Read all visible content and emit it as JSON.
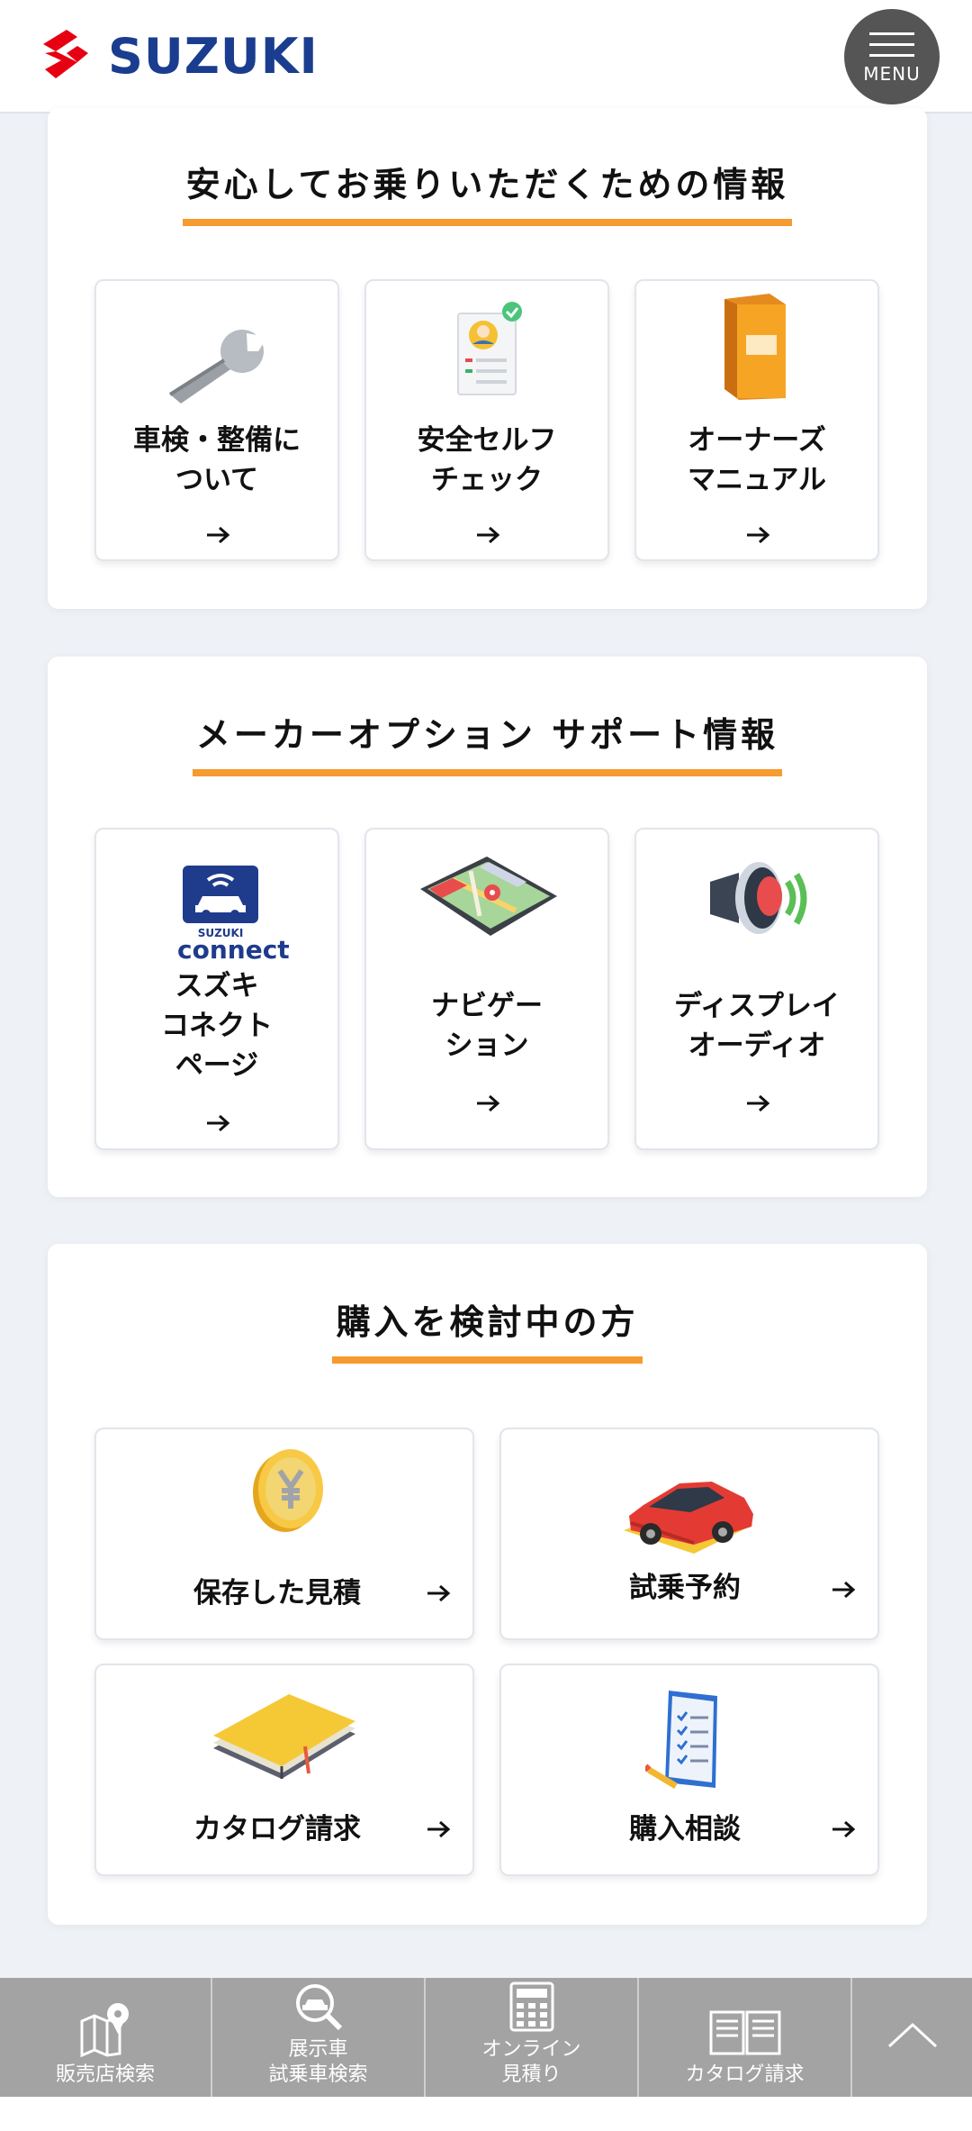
{
  "header": {
    "brand": "SUZUKI",
    "menu_label": "MENU",
    "brand_color": "#1a3d8f",
    "logo_color": "#e60012"
  },
  "sections": [
    {
      "title": "安心してお乗りいただくための情報",
      "cards": [
        {
          "label_lines": [
            "車検・整備に",
            "ついて"
          ],
          "icon": "wrench-icon"
        },
        {
          "label_lines": [
            "安全セルフ",
            "チェック"
          ],
          "icon": "checklist-icon"
        },
        {
          "label_lines": [
            "オーナーズ",
            "マニュアル"
          ],
          "icon": "manual-book-icon"
        }
      ]
    },
    {
      "title": "メーカーオプション サポート情報",
      "cards": [
        {
          "label_lines": [
            "スズキ",
            "コネクト",
            "ページ"
          ],
          "icon": "suzuki-connect-icon",
          "icon_text_top": "SUZUKI",
          "icon_text_bottom": "connect"
        },
        {
          "label_lines": [
            "ナビゲー",
            "ション"
          ],
          "icon": "navigation-tablet-icon"
        },
        {
          "label_lines": [
            "ディスプレイ",
            "オーディオ"
          ],
          "icon": "speaker-icon"
        }
      ]
    },
    {
      "title": "購入を検討中の方",
      "cards": [
        {
          "label": "保存した見積",
          "icon": "yen-coin-icon"
        },
        {
          "label": "試乗予約",
          "icon": "red-car-icon"
        },
        {
          "label": "カタログ請求",
          "icon": "catalog-book-icon"
        },
        {
          "label": "購入相談",
          "icon": "clipboard-icon"
        }
      ]
    }
  ],
  "accent_color": "#f59b2f",
  "bottom_nav": [
    {
      "label_lines": [
        "販売店検索"
      ],
      "icon": "map-pin-icon"
    },
    {
      "label_lines": [
        "展示車",
        "試乗車検索"
      ],
      "icon": "car-search-icon"
    },
    {
      "label_lines": [
        "オンライン",
        "見積り"
      ],
      "icon": "calculator-icon"
    },
    {
      "label_lines": [
        "カタログ請求"
      ],
      "icon": "open-book-icon"
    },
    {
      "label_lines": [],
      "icon": "scroll-top-chevron-icon"
    }
  ]
}
